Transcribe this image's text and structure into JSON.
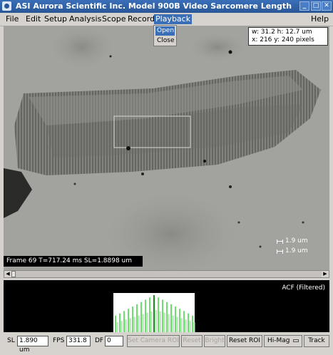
{
  "window": {
    "title": "ASI Aurora Scientific Inc.  Model 900B  Video Sarcomere Length",
    "buttons": [
      "_",
      "□",
      "✕"
    ]
  },
  "menubar": {
    "items": [
      {
        "label": "File"
      },
      {
        "label": "Edit"
      },
      {
        "label": "Setup"
      },
      {
        "label": "Analysis"
      },
      {
        "label": "Scope"
      },
      {
        "label": "Record"
      },
      {
        "label": "Playback"
      }
    ],
    "help": "Help",
    "active": "Playback"
  },
  "playback_menu": {
    "items": [
      {
        "label": "Open",
        "selected": true
      },
      {
        "label": "Close",
        "selected": false
      }
    ]
  },
  "viewport": {
    "roi_info": {
      "line1": "w: 31.2  h: 12.7  um",
      "line2": "x: 216  y: 240  pixels"
    },
    "frame_status": "Frame 69  T=717.24 ms  SL=1.8898 um",
    "scale_labels": [
      "1.9 um",
      "1.9 um"
    ]
  },
  "acf": {
    "title": "ACF (Filtered)"
  },
  "controls": {
    "sl_label": "SL",
    "sl_value": "1.890 um",
    "fps_label": "FPS",
    "fps_value": "331.8",
    "df_label": "DF",
    "df_value": "0",
    "set_camera_roi": "Set Camera ROI",
    "reset": "Reset",
    "bright": "Bright",
    "reset_roi": "Reset ROI",
    "magnification": "Hi-Mag",
    "track": "Track"
  },
  "colors": {
    "titlebar": "#2a5697",
    "selection": "#3a6fb8",
    "acf_signal": "#3cd23c"
  }
}
